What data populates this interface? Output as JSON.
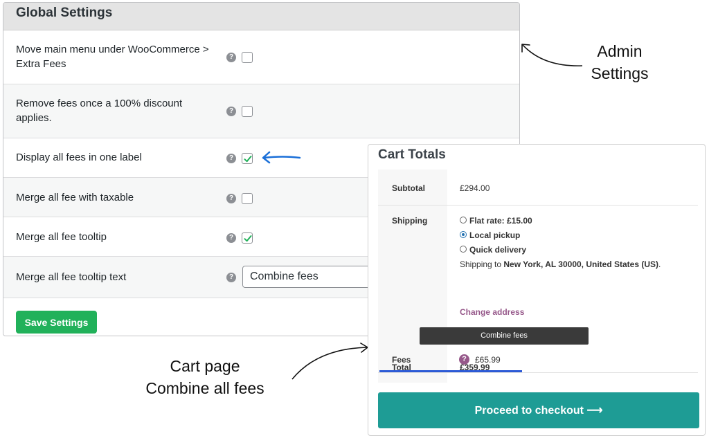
{
  "settings": {
    "title": "Global Settings",
    "help_glyph": "?",
    "rows": [
      {
        "label": "Move main menu under WooCommerce > Extra Fees",
        "control": "checkbox",
        "checked": false
      },
      {
        "label": "Remove fees once a 100% discount applies.",
        "control": "checkbox",
        "checked": false
      },
      {
        "label": "Display all fees in one label",
        "control": "checkbox",
        "checked": true
      },
      {
        "label": "Merge all fee with taxable",
        "control": "checkbox",
        "checked": false
      },
      {
        "label": "Merge all fee tooltip",
        "control": "checkbox",
        "checked": true
      },
      {
        "label": "Merge all fee tooltip text",
        "control": "text",
        "value": "Combine fees"
      }
    ],
    "save_label": "Save Settings",
    "save_color": "#21b15a"
  },
  "annotations": {
    "admin_line1": "Admin",
    "admin_line2": "Settings",
    "cart_line1": "Cart page",
    "cart_line2": "Combine all fees",
    "arrow_color": "#1a6fd8"
  },
  "cart": {
    "title": "Cart Totals",
    "subtotal_label": "Subtotal",
    "subtotal_value": "£294.00",
    "shipping_label": "Shipping",
    "shipping_options": [
      {
        "label": "Flat rate: £15.00",
        "selected": false
      },
      {
        "label": "Local pickup",
        "selected": true
      },
      {
        "label": "Quick delivery",
        "selected": false
      }
    ],
    "shipping_to_prefix": "Shipping to",
    "shipping_to_address": "New York, AL 30000, United States (US)",
    "shipping_to_suffix": ".",
    "change_address": "Change address",
    "tooltip_text": "Combine fees",
    "fees_label": "Fees",
    "fees_help_glyph": "?",
    "fees_value": "£65.99",
    "total_label": "Total",
    "total_value": "£359.99",
    "checkout_label": "Proceed to checkout",
    "checkout_arrow": "⟶",
    "checkout_color": "#1e9c95",
    "link_color": "#96588a"
  }
}
